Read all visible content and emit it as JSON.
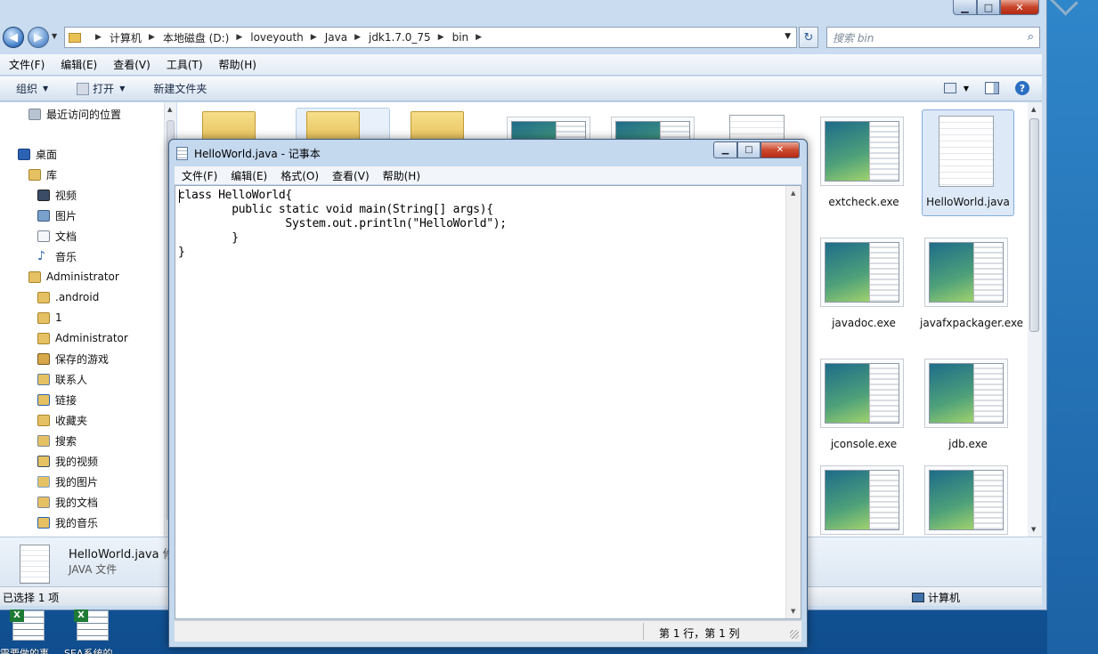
{
  "explorer": {
    "controls": {
      "min": "▁",
      "max": "□",
      "close": "✕"
    },
    "breadcrumb": [
      "计算机",
      "本地磁盘 (D:)",
      "loveyouth",
      "Java",
      "jdk1.7.0_75",
      "bin"
    ],
    "search_placeholder": "搜索 bin",
    "menu": [
      "文件(F)",
      "编辑(E)",
      "查看(V)",
      "工具(T)",
      "帮助(H)"
    ],
    "toolbar": {
      "organize": "组织",
      "open": "打开",
      "new_folder": "新建文件夹"
    },
    "nav": {
      "recent": "最近访问的位置",
      "desktop": "桌面",
      "library": "库",
      "videos": "视频",
      "pictures": "图片",
      "documents": "文档",
      "music": "音乐",
      "administrator": "Administrator",
      "android": ".android",
      "one": "1",
      "administrator2": "Administrator",
      "saved_games": "保存的游戏",
      "contacts": "联系人",
      "links": "链接",
      "favorites": "收藏夹",
      "searches": "搜索",
      "my_videos": "我的视频",
      "my_pictures": "我的图片",
      "my_documents": "我的文档",
      "my_music": "我的音乐"
    },
    "files": {
      "extcheck": "extcheck.exe",
      "helloworld": "HelloWorld.java",
      "javadoc": "javadoc.exe",
      "javafxpackager": "javafxpackager.exe",
      "jconsole": "jconsole.exe",
      "jdb": "jdb.exe"
    },
    "details": {
      "name": "HelloWorld.java",
      "extra": "修",
      "type": "JAVA 文件"
    },
    "status": {
      "selected": "已选择 1 项",
      "location": "计算机"
    }
  },
  "notepad": {
    "title": "HelloWorld.java - 记事本",
    "menu": [
      "文件(F)",
      "编辑(E)",
      "格式(O)",
      "查看(V)",
      "帮助(H)"
    ],
    "content": "class HelloWorld{\n        public static void main(String[] args){\n                System.out.println(\"HelloWorld\");\n        }\n}",
    "status": "第 1 行，第 1 列",
    "controls": {
      "min": "▁",
      "max": "□",
      "close": "✕"
    }
  },
  "desktop": {
    "icon1": "需要做的事",
    "icon2": "SEA系统的…"
  }
}
